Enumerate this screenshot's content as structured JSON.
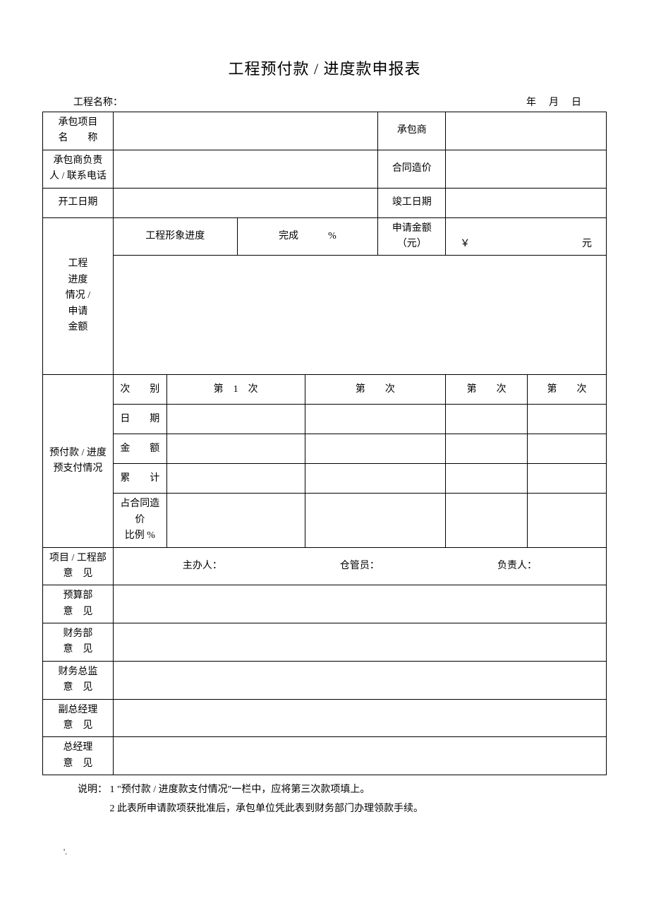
{
  "title": "工程预付款 / 进度款申报表",
  "header": {
    "project_name_label": "工程名称：",
    "date_label": "年　月　日"
  },
  "row1": {
    "contract_item_label_l1": "承包项目",
    "contract_item_label_l2": "名　　称",
    "contractor_label": "承包商"
  },
  "row2": {
    "contractor_leader_l1": "承包商负责",
    "contractor_leader_l2": "人 / 联系电话",
    "contract_price_label": "合同造价"
  },
  "row3": {
    "start_date_label": "开工日期",
    "finish_date_label": "竣工日期"
  },
  "progress": {
    "side_label_l1": "工程",
    "side_label_l2": "进度",
    "side_label_l3": "情况 /",
    "side_label_l4": "申请",
    "side_label_l5": "金额",
    "visual_progress_label": "工程形象进度",
    "completed_prefix": "完成",
    "completed_suffix": "%",
    "apply_amount_label_l1": "申请金额",
    "apply_amount_label_l2": "（元）",
    "yen": "￥",
    "yuan": "元"
  },
  "payments": {
    "side_label_l1": "预付款 / 进度",
    "side_label_l2": "预支付情况",
    "seq_label": "次　　别",
    "seq_1": "第　1　次",
    "seq_2": "第　　次",
    "seq_3": "第　　次",
    "seq_4": "第　　次",
    "date_label": "日　　期",
    "amount_label": "金　　额",
    "sum_label": "累　　计",
    "ratio_label_l1": "占合同造价",
    "ratio_label_l2": "比例 %"
  },
  "opinions": {
    "proj_dept_l1": "项目 / 工程部",
    "proj_dept_l2": "意　见",
    "handler_label": "主办人：",
    "warehouse_label": "仓管员：",
    "incharge_label": "负责人：",
    "budget_l1": "预算部",
    "budget_l2": "意　见",
    "finance_l1": "财务部",
    "finance_l2": "意　见",
    "cfo_l1": "财务总监",
    "cfo_l2": "意　见",
    "vgm_l1": "副总经理",
    "vgm_l2": "意　见",
    "gm_l1": "总经理",
    "gm_l2": "意　见"
  },
  "notes": {
    "prefix": "说明：",
    "n1": "1 \"预付款 / 进度款支付情况\"一栏中，应将第三次款项填上。",
    "n2": "2 此表所申请款项获批准后，承包单位凭此表到财务部门办理领款手续。"
  },
  "tick": "'."
}
